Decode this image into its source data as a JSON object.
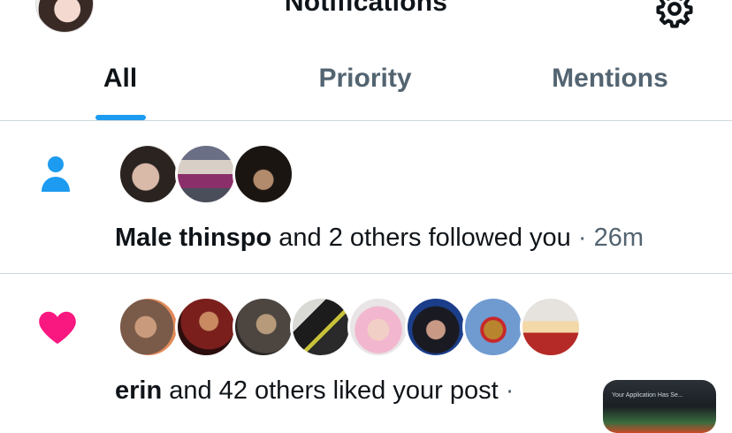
{
  "header": {
    "title": "Notifications",
    "settings_icon": "gear-icon"
  },
  "tabs": [
    {
      "label": "All",
      "active": true
    },
    {
      "label": "Priority",
      "active": false
    },
    {
      "label": "Mentions",
      "active": false
    }
  ],
  "accent_color": "#1d9bf0",
  "notifications": [
    {
      "type_icon": "person-icon",
      "type_color": "#1d9bf0",
      "actor": "Male thinspo",
      "action": " and 2 others followed you",
      "separator": " · ",
      "time": "26m",
      "avatar_count": 3
    },
    {
      "type_icon": "heart-icon",
      "type_color": "#f91880",
      "actor": "erin",
      "action": " and 42 others liked your post",
      "separator": " ·",
      "avatar_count": 8,
      "thumbnail_text": "Your Application Has Se..."
    }
  ]
}
